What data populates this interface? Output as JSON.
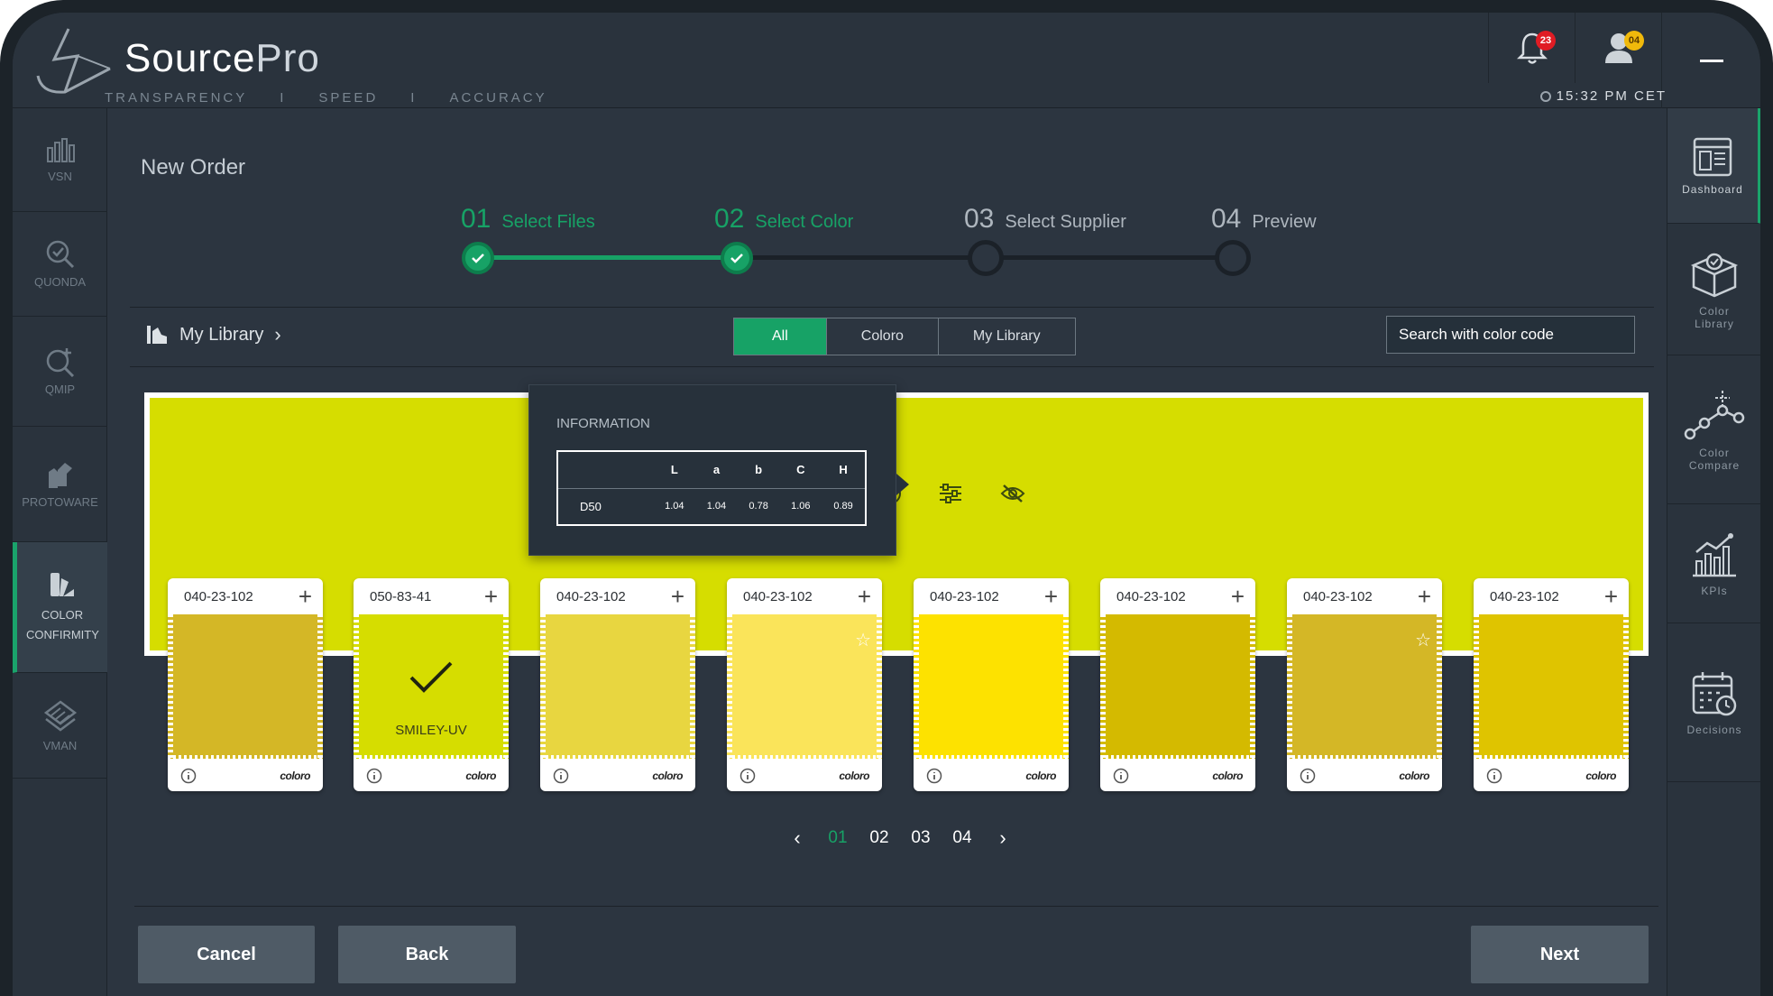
{
  "header": {
    "brand_main": "Source",
    "brand_pro": "Pro",
    "tagline": [
      "TRANSPARENCY",
      "I",
      "SPEED",
      "I",
      "ACCURACY"
    ],
    "time": "15:32 PM CET",
    "notifications_count": "23",
    "user_count": "04"
  },
  "left_nav": [
    {
      "label": "VSN",
      "icon": "bar-chart-icon"
    },
    {
      "label": "QUONDA",
      "icon": "search-check-icon"
    },
    {
      "label": "QMIP",
      "icon": "search-plus-icon"
    },
    {
      "label": "PROTOWARE",
      "icon": "hand-shirt-icon"
    },
    {
      "label": "COLOR CONFIRMITY",
      "icon": "color-swatch-icon",
      "active": true
    },
    {
      "label": "VMAN",
      "icon": "layers-icon"
    }
  ],
  "right_nav": [
    {
      "label": "Dashboard",
      "icon": "dashboard-icon",
      "active": true
    },
    {
      "label": "Color Library",
      "icon": "box-icon"
    },
    {
      "label": "Color Compare",
      "icon": "graph-nodes-icon"
    },
    {
      "label": "KPIs",
      "icon": "kpi-chart-icon"
    },
    {
      "label": "Decisions",
      "icon": "calendar-icon"
    }
  ],
  "page": {
    "title": "New Order"
  },
  "steps": [
    {
      "num": "01",
      "label": "Select Files",
      "status": "done"
    },
    {
      "num": "02",
      "label": "Select Color",
      "status": "done"
    },
    {
      "num": "03",
      "label": "Select Supplier",
      "status": "todo"
    },
    {
      "num": "04",
      "label": "Preview",
      "status": "todo"
    }
  ],
  "library": {
    "label": "My Library"
  },
  "filters": {
    "all": "All",
    "coloro": "Coloro",
    "my_library": "My Library",
    "selected": "All"
  },
  "search": {
    "placeholder": "Search with color code"
  },
  "hero": {
    "color": "#d6dd00"
  },
  "info": {
    "title": "INFORMATION",
    "columns": [
      "L",
      "a",
      "b",
      "C",
      "H"
    ],
    "row_label": "D50",
    "values": [
      "1.04",
      "1.04",
      "0.78",
      "1.06",
      "0.89"
    ]
  },
  "swatches": [
    {
      "code": "040-23-102",
      "color": "#d4b726",
      "brand": "coloro"
    },
    {
      "code": "050-83-41",
      "color": "#d6dd00",
      "brand": "coloro",
      "selected": true,
      "name": "SMILEY-UV"
    },
    {
      "code": "040-23-102",
      "color": "#e8d640",
      "brand": "coloro"
    },
    {
      "code": "040-23-102",
      "color": "#fae45a",
      "brand": "coloro",
      "starred": true
    },
    {
      "code": "040-23-102",
      "color": "#fde200",
      "brand": "coloro"
    },
    {
      "code": "040-23-102",
      "color": "#d4ba00",
      "brand": "coloro"
    },
    {
      "code": "040-23-102",
      "color": "#d4b726",
      "brand": "coloro",
      "starred": true
    },
    {
      "code": "040-23-102",
      "color": "#dfc400",
      "brand": "coloro"
    }
  ],
  "pagination": {
    "pages": [
      "01",
      "02",
      "03",
      "04"
    ],
    "current": "01"
  },
  "actions": {
    "cancel": "Cancel",
    "back": "Back",
    "next": "Next"
  },
  "colors": {
    "accent": "#17a266",
    "bg": "#2c3540",
    "button": "#4f5b66"
  }
}
